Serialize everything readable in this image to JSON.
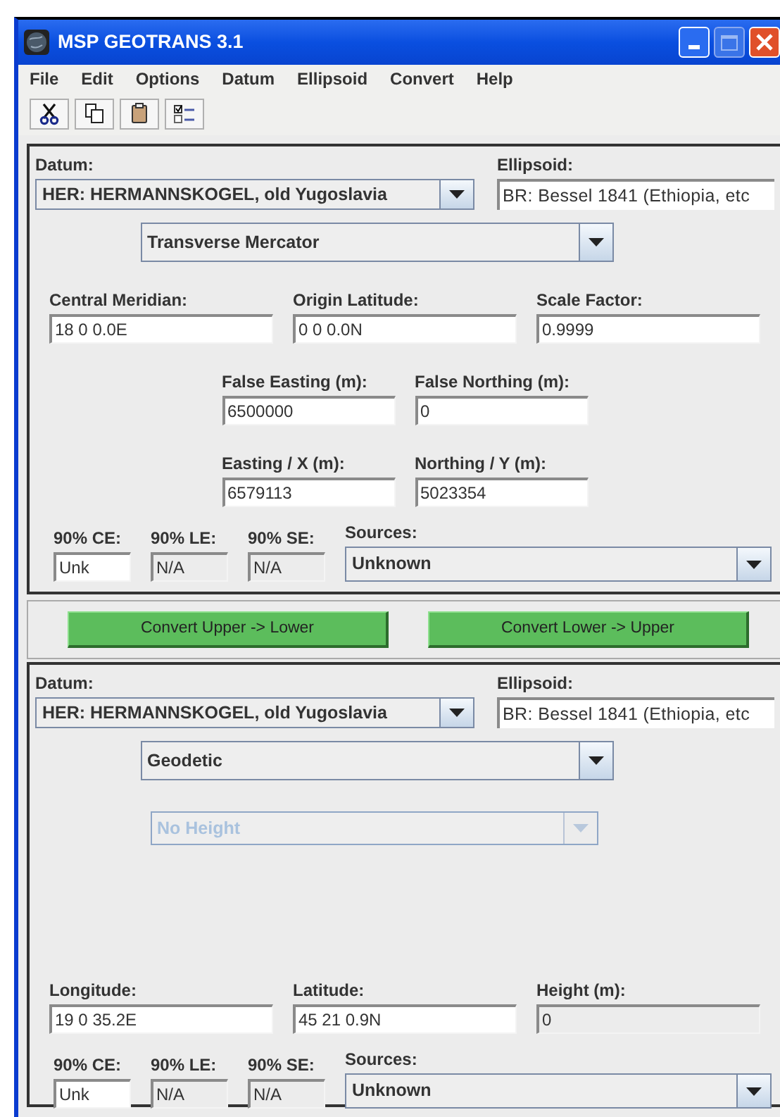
{
  "window": {
    "title": "MSP GEOTRANS 3.1"
  },
  "menu": [
    {
      "label": "File"
    },
    {
      "label": "Edit"
    },
    {
      "label": "Options"
    },
    {
      "label": "Datum"
    },
    {
      "label": "Ellipsoid"
    },
    {
      "label": "Convert"
    },
    {
      "label": "Help"
    }
  ],
  "toolbar": [
    {
      "kind": "cut"
    },
    {
      "kind": "copy"
    },
    {
      "kind": "paste"
    },
    {
      "kind": "options"
    }
  ],
  "upper_panel": {
    "datum": {
      "label": "Datum:",
      "value": "HER:  HERMANNSKOGEL, old Yugoslavia"
    },
    "ellipsoid": {
      "label": "Ellipsoid:",
      "value": "BR:  Bessel 1841 (Ethiopia, etc"
    },
    "coordinate_type": {
      "value": "Transverse Mercator"
    },
    "field_rows": [
      [
        {
          "label": "Central Meridian:",
          "value": "18 0 0.0E",
          "disabled": false
        },
        {
          "label": "Origin Latitude:",
          "value": "0 0 0.0N",
          "disabled": false
        },
        {
          "label": "Scale Factor:",
          "value": "0.9999",
          "disabled": false
        }
      ],
      [
        {
          "label": "False Easting (m):",
          "value": "6500000",
          "disabled": false
        },
        {
          "label": "False Northing (m):",
          "value": "0",
          "disabled": false
        }
      ],
      [
        {
          "label": "Easting / X (m):",
          "value": "6579113",
          "disabled": false
        },
        {
          "label": "Northing / Y (m):",
          "value": "5023354",
          "disabled": false
        }
      ]
    ],
    "accuracy": [
      {
        "label": "90% CE:",
        "value": "Unk",
        "disabled": false
      },
      {
        "label": "90% LE:",
        "value": "N/A",
        "disabled": true
      },
      {
        "label": "90% SE:",
        "value": "N/A",
        "disabled": true
      }
    ],
    "sources": {
      "label": "Sources:",
      "value": "Unknown"
    }
  },
  "convert_buttons": [
    "Convert Upper -> Lower",
    "Convert Lower -> Upper"
  ],
  "lower_panel": {
    "datum": {
      "label": "Datum:",
      "value": "HER:  HERMANNSKOGEL, old Yugoslavia"
    },
    "ellipsoid": {
      "label": "Ellipsoid:",
      "value": "BR:  Bessel 1841 (Ethiopia, etc"
    },
    "coordinate_type": {
      "value": "Geodetic"
    },
    "height_type": {
      "value": "No Height",
      "disabled": true
    },
    "field_rows": [
      [
        {
          "label": "Longitude:",
          "value": "19 0 35.2E",
          "disabled": false
        },
        {
          "label": "Latitude:",
          "value": "45 21 0.9N",
          "disabled": false
        },
        {
          "label": "Height (m):",
          "value": "0",
          "disabled": true
        }
      ]
    ],
    "accuracy": [
      {
        "label": "90% CE:",
        "value": "Unk",
        "disabled": false
      },
      {
        "label": "90% LE:",
        "value": "N/A",
        "disabled": true
      },
      {
        "label": "90% SE:",
        "value": "N/A",
        "disabled": true
      }
    ],
    "sources": {
      "label": "Sources:",
      "value": "Unknown"
    }
  }
}
